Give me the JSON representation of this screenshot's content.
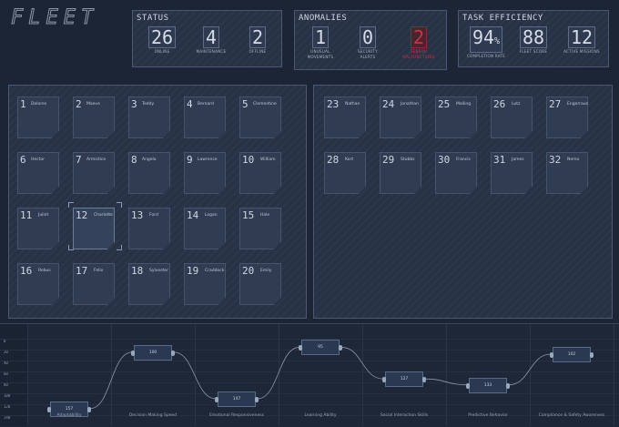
{
  "app": {
    "logo_text": "FLEET"
  },
  "status": {
    "title": "STATUS",
    "items": [
      {
        "value": "26",
        "label": "ONLINE"
      },
      {
        "value": "4",
        "label": "MAINTENANCE"
      },
      {
        "value": "2",
        "label": "OFFLINE"
      }
    ]
  },
  "anomalies": {
    "title": "ANOMALIES",
    "items": [
      {
        "value": "1",
        "label1": "UNUSUAL",
        "label2": "MOVEMENTS"
      },
      {
        "value": "0",
        "label1": "SECURITY",
        "label2": "ALERTS"
      },
      {
        "value": "2",
        "label1": "SENSOR",
        "label2": "MALFUNCTIONS",
        "alert": true
      }
    ]
  },
  "efficiency": {
    "title": "TASK EFFICIENCY",
    "items": [
      {
        "value": "94",
        "suffix": "%",
        "label": "COMPLETION RATE"
      },
      {
        "value": "88",
        "label": "FLEET SCORE"
      },
      {
        "value": "12",
        "label": "ACTIVE MISSIONS"
      }
    ]
  },
  "agents_left": [
    {
      "num": "1",
      "name": "Dolores"
    },
    {
      "num": "2",
      "name": "Maeve"
    },
    {
      "num": "3",
      "name": "Teddy"
    },
    {
      "num": "4",
      "name": "Bernard"
    },
    {
      "num": "5",
      "name": "Clementine"
    },
    {
      "num": "6",
      "name": "Hector"
    },
    {
      "num": "7",
      "name": "Armistice"
    },
    {
      "num": "8",
      "name": "Angela"
    },
    {
      "num": "9",
      "name": "Lawrence"
    },
    {
      "num": "10",
      "name": "William"
    },
    {
      "num": "11",
      "name": "Juliet"
    },
    {
      "num": "12",
      "name": "Charlotte"
    },
    {
      "num": "13",
      "name": "Ford"
    },
    {
      "num": "14",
      "name": "Logan"
    },
    {
      "num": "15",
      "name": "Hale"
    },
    {
      "num": "16",
      "name": "Rebus"
    },
    {
      "num": "17",
      "name": "Felix"
    },
    {
      "num": "18",
      "name": "Sylvester"
    },
    {
      "num": "19",
      "name": "Craddock"
    },
    {
      "num": "20",
      "name": "Emily"
    }
  ],
  "agents_right": [
    {
      "num": "23",
      "name": "Nathan"
    },
    {
      "num": "24",
      "name": "Jonathan"
    },
    {
      "num": "25",
      "name": "Malling"
    },
    {
      "num": "26",
      "name": "Lutz"
    },
    {
      "num": "27",
      "name": "Engerraund"
    },
    {
      "num": "28",
      "name": "Kort"
    },
    {
      "num": "29",
      "name": "Stubbs"
    },
    {
      "num": "30",
      "name": "Francis"
    },
    {
      "num": "31",
      "name": "James"
    },
    {
      "num": "32",
      "name": "Nemo"
    }
  ],
  "y_axis": [
    "0",
    "20",
    "40",
    "60",
    "80",
    "100",
    "120",
    "140"
  ],
  "traits": [
    {
      "label": "Adaptability",
      "value": "157"
    },
    {
      "label": "Decision Making Speed",
      "value": "100"
    },
    {
      "label": "Emotional Responsiveness",
      "value": "147"
    },
    {
      "label": "Learning Ability",
      "value": "95"
    },
    {
      "label": "Social Interaction Skills",
      "value": "127"
    },
    {
      "label": "Predictive Behavior",
      "value": "133"
    },
    {
      "label": "Compliance & Safety Awareness",
      "value": "102"
    }
  ],
  "colors": {
    "accent": "#d03040",
    "panel": "#273246",
    "background": "#1b2535"
  }
}
